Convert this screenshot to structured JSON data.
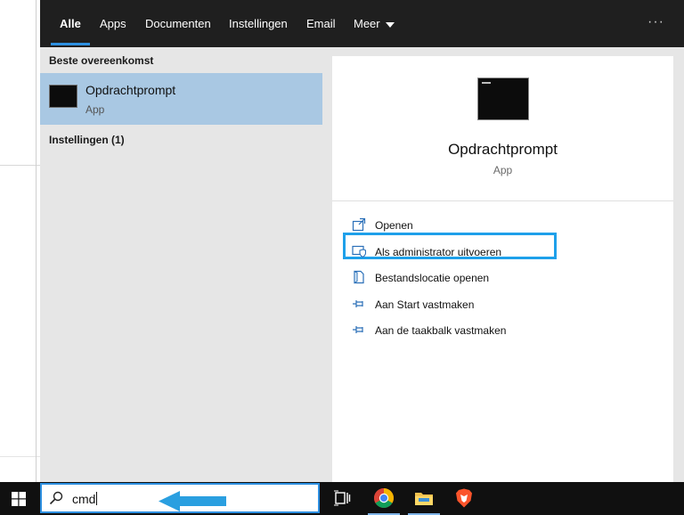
{
  "search_flyout": {
    "tabs": [
      {
        "label": "Alle",
        "active": true
      },
      {
        "label": "Apps",
        "active": false
      },
      {
        "label": "Documenten",
        "active": false
      },
      {
        "label": "Instellingen",
        "active": false
      },
      {
        "label": "Email",
        "active": false
      },
      {
        "label": "Meer",
        "active": false,
        "dropdown": true
      }
    ],
    "more_options": "···",
    "results": {
      "best_match_header": "Beste overeenkomst",
      "best_match": {
        "title": "Opdrachtprompt",
        "subtitle": "App",
        "icon": "terminal-icon"
      },
      "settings_header": "Instellingen (1)"
    },
    "detail": {
      "title": "Opdrachtprompt",
      "subtitle": "App",
      "icon": "terminal-icon",
      "actions": [
        {
          "label": "Openen",
          "icon": "open-icon"
        },
        {
          "label": "Als administrator uitvoeren",
          "icon": "run-as-admin-icon",
          "highlighted": true
        },
        {
          "label": "Bestandslocatie openen",
          "icon": "file-location-icon"
        },
        {
          "label": "Aan Start vastmaken",
          "icon": "pin-icon"
        },
        {
          "label": "Aan de taakbalk vastmaken",
          "icon": "pin-icon"
        }
      ]
    }
  },
  "taskbar": {
    "search_value": "cmd",
    "search_icon": "search-icon",
    "start_icon": "windows-logo-icon",
    "apps": [
      {
        "name": "task-view-icon"
      },
      {
        "name": "chrome-icon"
      },
      {
        "name": "file-explorer-icon"
      },
      {
        "name": "brave-icon"
      }
    ]
  },
  "colors": {
    "accent": "#2d8fe0",
    "highlight_box": "#1ea0ea",
    "selected_result": "#a9c8e3",
    "annotation_arrow": "#2a9fe0"
  }
}
